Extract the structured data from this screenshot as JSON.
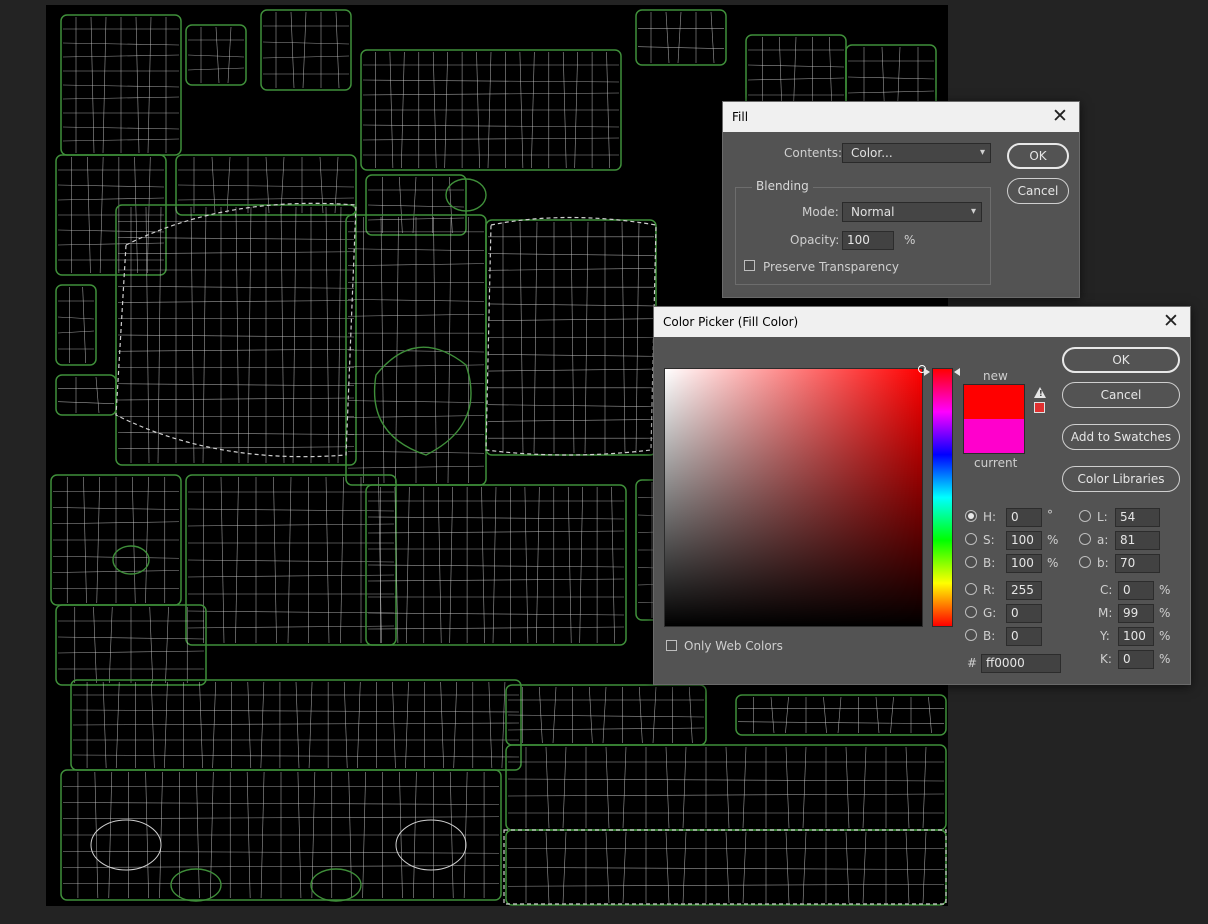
{
  "fill_dialog": {
    "title": "Fill",
    "contents_label": "Contents:",
    "contents_value": "Color...",
    "blending_legend": "Blending",
    "mode_label": "Mode:",
    "mode_value": "Normal",
    "opacity_label": "Opacity:",
    "opacity_value": "100",
    "opacity_unit": "%",
    "preserve_label": "Preserve Transparency",
    "preserve_checked": false,
    "ok_label": "OK",
    "cancel_label": "Cancel"
  },
  "color_picker": {
    "title": "Color Picker (Fill Color)",
    "ok_label": "OK",
    "cancel_label": "Cancel",
    "add_swatches_label": "Add to Swatches",
    "libraries_label": "Color Libraries",
    "new_label": "new",
    "current_label": "current",
    "new_color": "#ff0000",
    "current_color": "#ff00cc",
    "gamut_swatch_color": "#e03030",
    "only_web_label": "Only Web Colors",
    "only_web_checked": false,
    "hsb": {
      "h_label": "H:",
      "h_value": "0",
      "h_unit": "°",
      "s_label": "S:",
      "s_value": "100",
      "s_unit": "%",
      "b_label": "B:",
      "b_value": "100",
      "b_unit": "%"
    },
    "rgb": {
      "r_label": "R:",
      "r_value": "255",
      "g_label": "G:",
      "g_value": "0",
      "b_label": "B:",
      "b_value": "0"
    },
    "lab": {
      "l_label": "L:",
      "l_value": "54",
      "a_label": "a:",
      "a_value": "81",
      "b_label": "b:",
      "b_value": "70"
    },
    "cmyk": {
      "c_label": "C:",
      "c_value": "0",
      "c_unit": "%",
      "m_label": "M:",
      "m_value": "99",
      "m_unit": "%",
      "y_label": "Y:",
      "y_value": "100",
      "y_unit": "%",
      "k_label": "K:",
      "k_value": "0",
      "k_unit": "%"
    },
    "hex_label": "#",
    "hex_value": "ff0000",
    "selected_hue_deg": 0,
    "selected_saturation": 1.0,
    "selected_brightness": 1.0
  },
  "icons": {
    "close": "close-icon",
    "dropdown": "chevron-down-icon",
    "gamut_warning": "warning-icon"
  },
  "canvas": {
    "background_color": "#000000",
    "wire_green": "#3f8f3a",
    "wire_white": "#cfcfcf"
  }
}
